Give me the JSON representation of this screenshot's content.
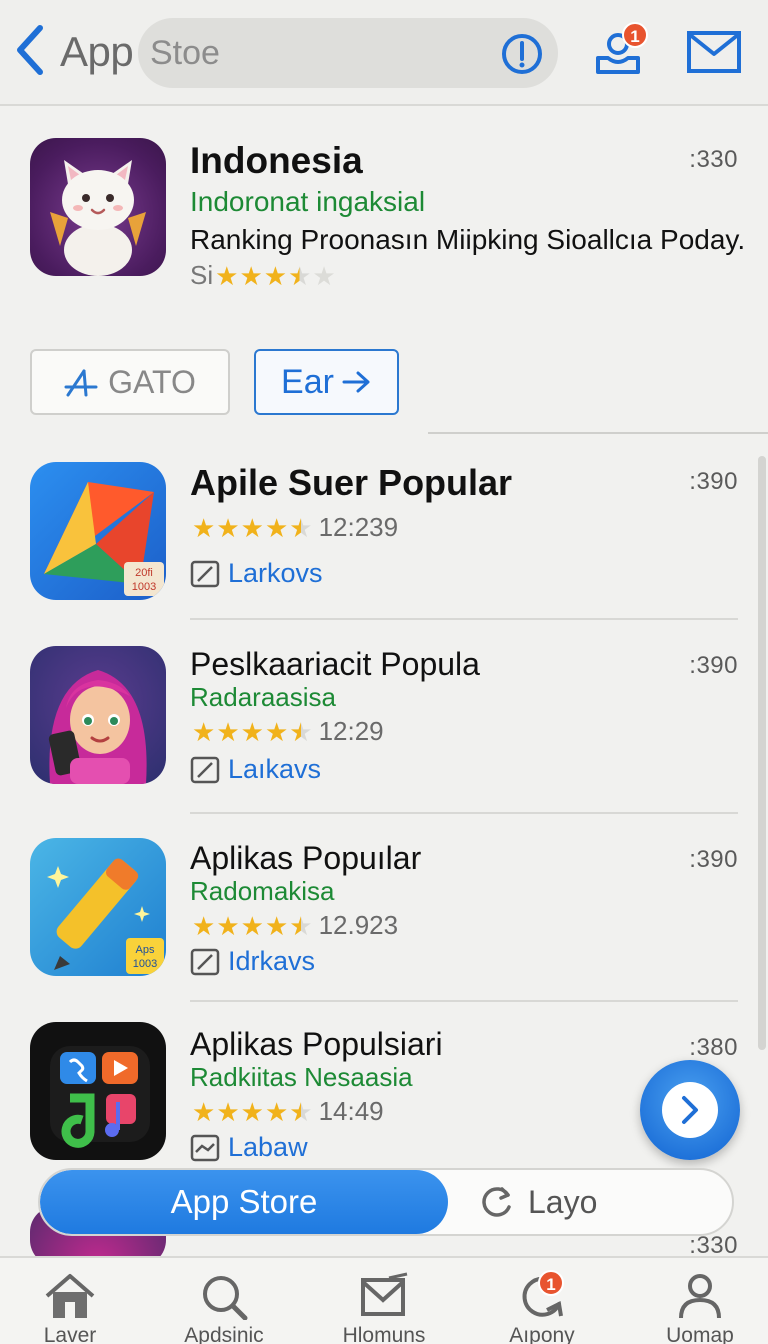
{
  "header": {
    "title": "App",
    "search_text": "Stoe",
    "user_badge": "1"
  },
  "featured": {
    "title": "Indonesia",
    "subtitle": "Indoronat ingaksial",
    "description": "Ranking Proonasın Miipking Sioallcıa Poday.",
    "rating_prefix": "Si",
    "rating": 3.5,
    "meta": ":330",
    "buttons": {
      "primary_label": "GATO",
      "secondary_label": "Ear"
    }
  },
  "apps": [
    {
      "title": "Apile Suer Popular",
      "subtitle": "",
      "rating": 4.5,
      "rating_text": "12:239",
      "link": "Larkovs",
      "meta": ":390",
      "icon_badge": "20fi 1003"
    },
    {
      "title": "Peslkaariacit Popula",
      "subtitle": "Radaraasisa",
      "rating": 4.5,
      "rating_text": "12:29",
      "link": "Laıkavs",
      "meta": ":390"
    },
    {
      "title": "Aplikas Popuılar",
      "subtitle": "Radomakisa",
      "rating": 4.5,
      "rating_text": "12.923",
      "link": "Idrkavs",
      "meta": ":390",
      "icon_badge": "Aps 1003"
    },
    {
      "title": "Aplikas Populsiari",
      "subtitle": "Radkiitas Nesaasia",
      "rating": 4.5,
      "rating_text": "14:49",
      "link": "Labaw",
      "meta": ":380"
    }
  ],
  "partial_row": {
    "meta": ":330"
  },
  "segmented": {
    "active": "App Store",
    "inactive": "Layo"
  },
  "tabs": [
    {
      "label": "Laver",
      "icon": "home-icon"
    },
    {
      "label": "Apdsinic",
      "icon": "search-icon"
    },
    {
      "label": "Hlomuns",
      "icon": "inbox-icon"
    },
    {
      "label": "Aıpony",
      "icon": "refresh-icon",
      "badge": "1"
    },
    {
      "label": "Uomap",
      "icon": "person-icon"
    }
  ],
  "colors": {
    "accent": "#1f6fd6",
    "green": "#1d8a35",
    "star": "#f1b21b",
    "badge": "#e8542f"
  }
}
